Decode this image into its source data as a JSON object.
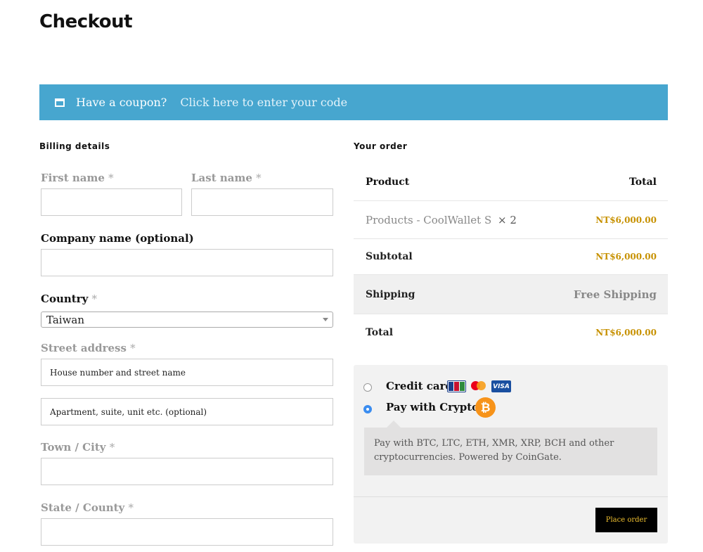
{
  "page": {
    "title": "Checkout"
  },
  "coupon": {
    "text": "Have a coupon?",
    "link": "Click here to enter your code"
  },
  "billing": {
    "title": "Billing details",
    "required_mark": "*",
    "first_name_label": "First name",
    "last_name_label": "Last name",
    "company_label": "Company name (optional)",
    "country_label": "Country",
    "country_value": "Taiwan",
    "street_label": "Street address",
    "street_placeholder": "House number and street name",
    "apartment_placeholder": "Apartment, suite, unit etc. (optional)",
    "city_label": "Town / City",
    "state_label": "State / County"
  },
  "order": {
    "title": "Your order",
    "header": {
      "product": "Product",
      "total": "Total"
    },
    "item": {
      "name": "Products - CoolWallet S",
      "qty": "× 2",
      "price": "NT$6,000.00"
    },
    "subtotal": {
      "label": "Subtotal",
      "value": "NT$6,000.00"
    },
    "shipping": {
      "label": "Shipping",
      "value": "Free Shipping"
    },
    "total": {
      "label": "Total",
      "value": "NT$6,000.00"
    }
  },
  "payment": {
    "credit_card_label": "Credit card",
    "credit_card_selected": false,
    "crypto_label": "Pay with Crypto",
    "crypto_selected": true,
    "card_icons": [
      "jcb-icon",
      "mastercard-icon",
      "visa-icon"
    ],
    "visa_text": "VISA",
    "bitcoin_symbol": "₿",
    "crypto_description": "Pay with BTC, LTC, ETH, XMR, XRP, BCH and other cryptocurrencies. Powered by CoinGate.",
    "place_order": "Place order"
  },
  "colors": {
    "coupon_bar": "#47a6cf",
    "price": "#c79100",
    "radio_selected": "#3b8df0",
    "bitcoin": "#f7931a",
    "button_bg": "#000000"
  }
}
